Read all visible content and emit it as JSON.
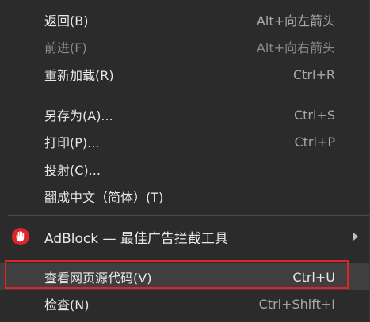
{
  "context_menu": {
    "items": [
      {
        "label": "返回(B)",
        "shortcut": "Alt+向左箭头"
      },
      {
        "label": "前进(F)",
        "shortcut": "Alt+向右箭头"
      },
      {
        "label": "重新加载(R)",
        "shortcut": "Ctrl+R"
      },
      {
        "label": "另存为(A)...",
        "shortcut": "Ctrl+S"
      },
      {
        "label": "打印(P)...",
        "shortcut": "Ctrl+P"
      },
      {
        "label": "投射(C)...",
        "shortcut": ""
      },
      {
        "label": "翻成中文（简体）(T)",
        "shortcut": ""
      },
      {
        "label": "AdBlock — 最佳广告拦截工具",
        "shortcut": "",
        "icon": "adblock-hand-icon"
      },
      {
        "label": "查看网页源代码(V)",
        "shortcut": "Ctrl+U"
      },
      {
        "label": "检查(N)",
        "shortcut": "Ctrl+Shift+I"
      }
    ]
  },
  "colors": {
    "menu_background": "#2b2b2b",
    "text": "#e8e8e8",
    "disabled_text": "#8a8a8a",
    "highlight_background": "#3f3f3f",
    "focus_border": "#e0222b",
    "adblock_red": "#e0222b"
  }
}
